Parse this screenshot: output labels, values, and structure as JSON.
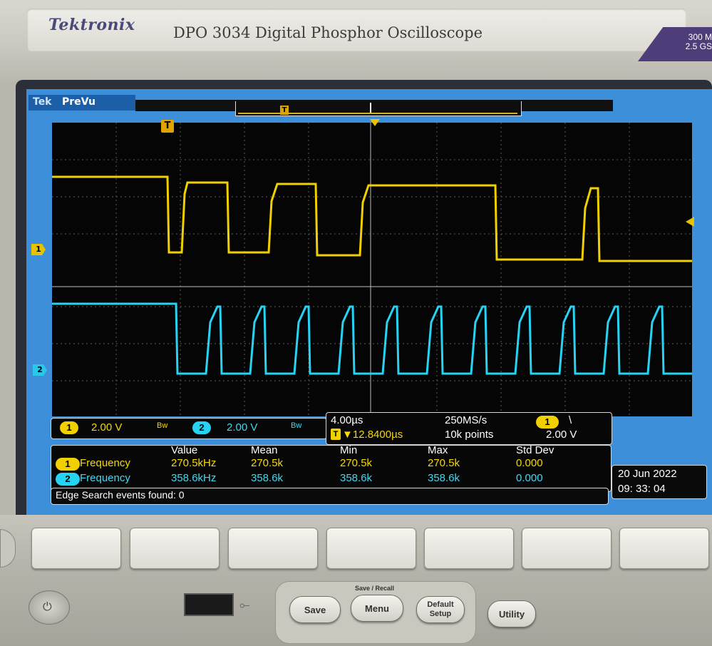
{
  "header": {
    "brand": "Tektronix",
    "model": "DPO 3034 Digital Phosphor Oscilloscope",
    "spec_line1": "300 M",
    "spec_line2": "2.5 GS"
  },
  "status": {
    "brand_short": "Tek",
    "mode": "PreVu",
    "trigger_marker": "T"
  },
  "markers": {
    "ch1": "1",
    "ch2": "2",
    "trigger": "T"
  },
  "vertical": {
    "ch1_badge": "1",
    "ch1_scale": "2.00 V",
    "ch2_badge": "2",
    "ch2_scale": "2.00 V"
  },
  "timebase": {
    "horizontal_scale": "4.00µs",
    "sample_rate": "250MS/s",
    "trigger_delay": "▼12.8400µs",
    "record_length": "10k points",
    "trigger_source": "1",
    "trigger_slope": "\\",
    "trigger_level": "2.00 V"
  },
  "measurements": {
    "headers": [
      "Value",
      "Mean",
      "Min",
      "Max",
      "Std Dev"
    ],
    "rows": [
      {
        "badge": "1",
        "name": "Frequency",
        "value": "270.5kHz",
        "mean": "270.5k",
        "min": "270.5k",
        "max": "270.5k",
        "std": "0.000"
      },
      {
        "badge": "2",
        "name": "Frequency",
        "value": "358.6kHz",
        "mean": "358.6k",
        "min": "358.6k",
        "max": "358.6k",
        "std": "0.000"
      }
    ]
  },
  "edge_search": "Edge Search events found: 0",
  "datetime": {
    "date": "20 Jun   2022",
    "time": "09: 33: 04"
  },
  "controls": {
    "group_title": "Save / Recall",
    "save": "Save",
    "menu": "Menu",
    "default_setup_1": "Default",
    "default_setup_2": "Setup",
    "utility": "Utility"
  },
  "colors": {
    "ch1": "#f1d000",
    "ch2": "#27d3f2",
    "screen_bg": "#3c8fd8"
  }
}
